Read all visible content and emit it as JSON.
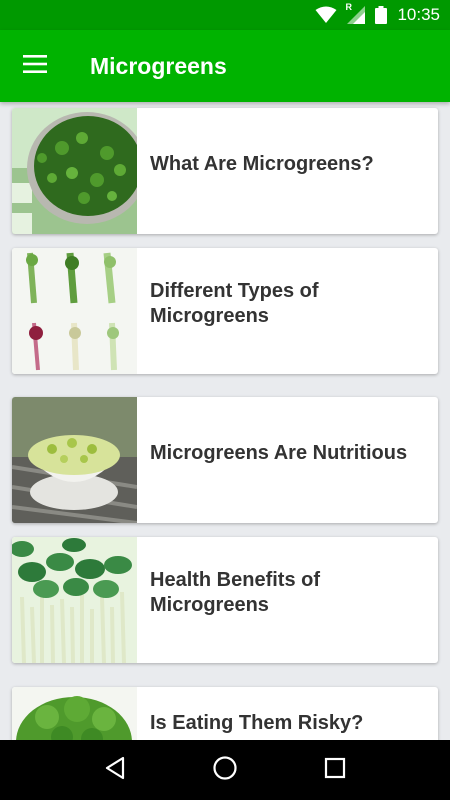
{
  "status_bar": {
    "time": "10:35",
    "icons": [
      "wifi-icon",
      "signal-icon",
      "battery-icon"
    ],
    "signal_badge": "R"
  },
  "app_bar": {
    "title": "Microgreens",
    "menu_icon": "hamburger-menu-icon"
  },
  "articles": [
    {
      "title": "What Are Microgreens?",
      "image": "microgreens-tray-photo"
    },
    {
      "title": "Different Types of Microgreens",
      "image": "microgreens-varieties-photo"
    },
    {
      "title": "Microgreens Are Nutritious",
      "image": "sprouts-bowl-photo"
    },
    {
      "title": "Health Benefits of Microgreens",
      "image": "microgreens-closeup-photo"
    },
    {
      "title": "Is Eating Them Risky?",
      "image": "microgreens-leaves-photo"
    }
  ],
  "nav_bar": {
    "icons": [
      "back-icon",
      "home-icon",
      "recents-icon"
    ]
  },
  "colors": {
    "status_bar": "#009900",
    "app_bar": "#00b300",
    "background": "#e9ebee",
    "card": "#ffffff",
    "card_title": "#333333"
  }
}
